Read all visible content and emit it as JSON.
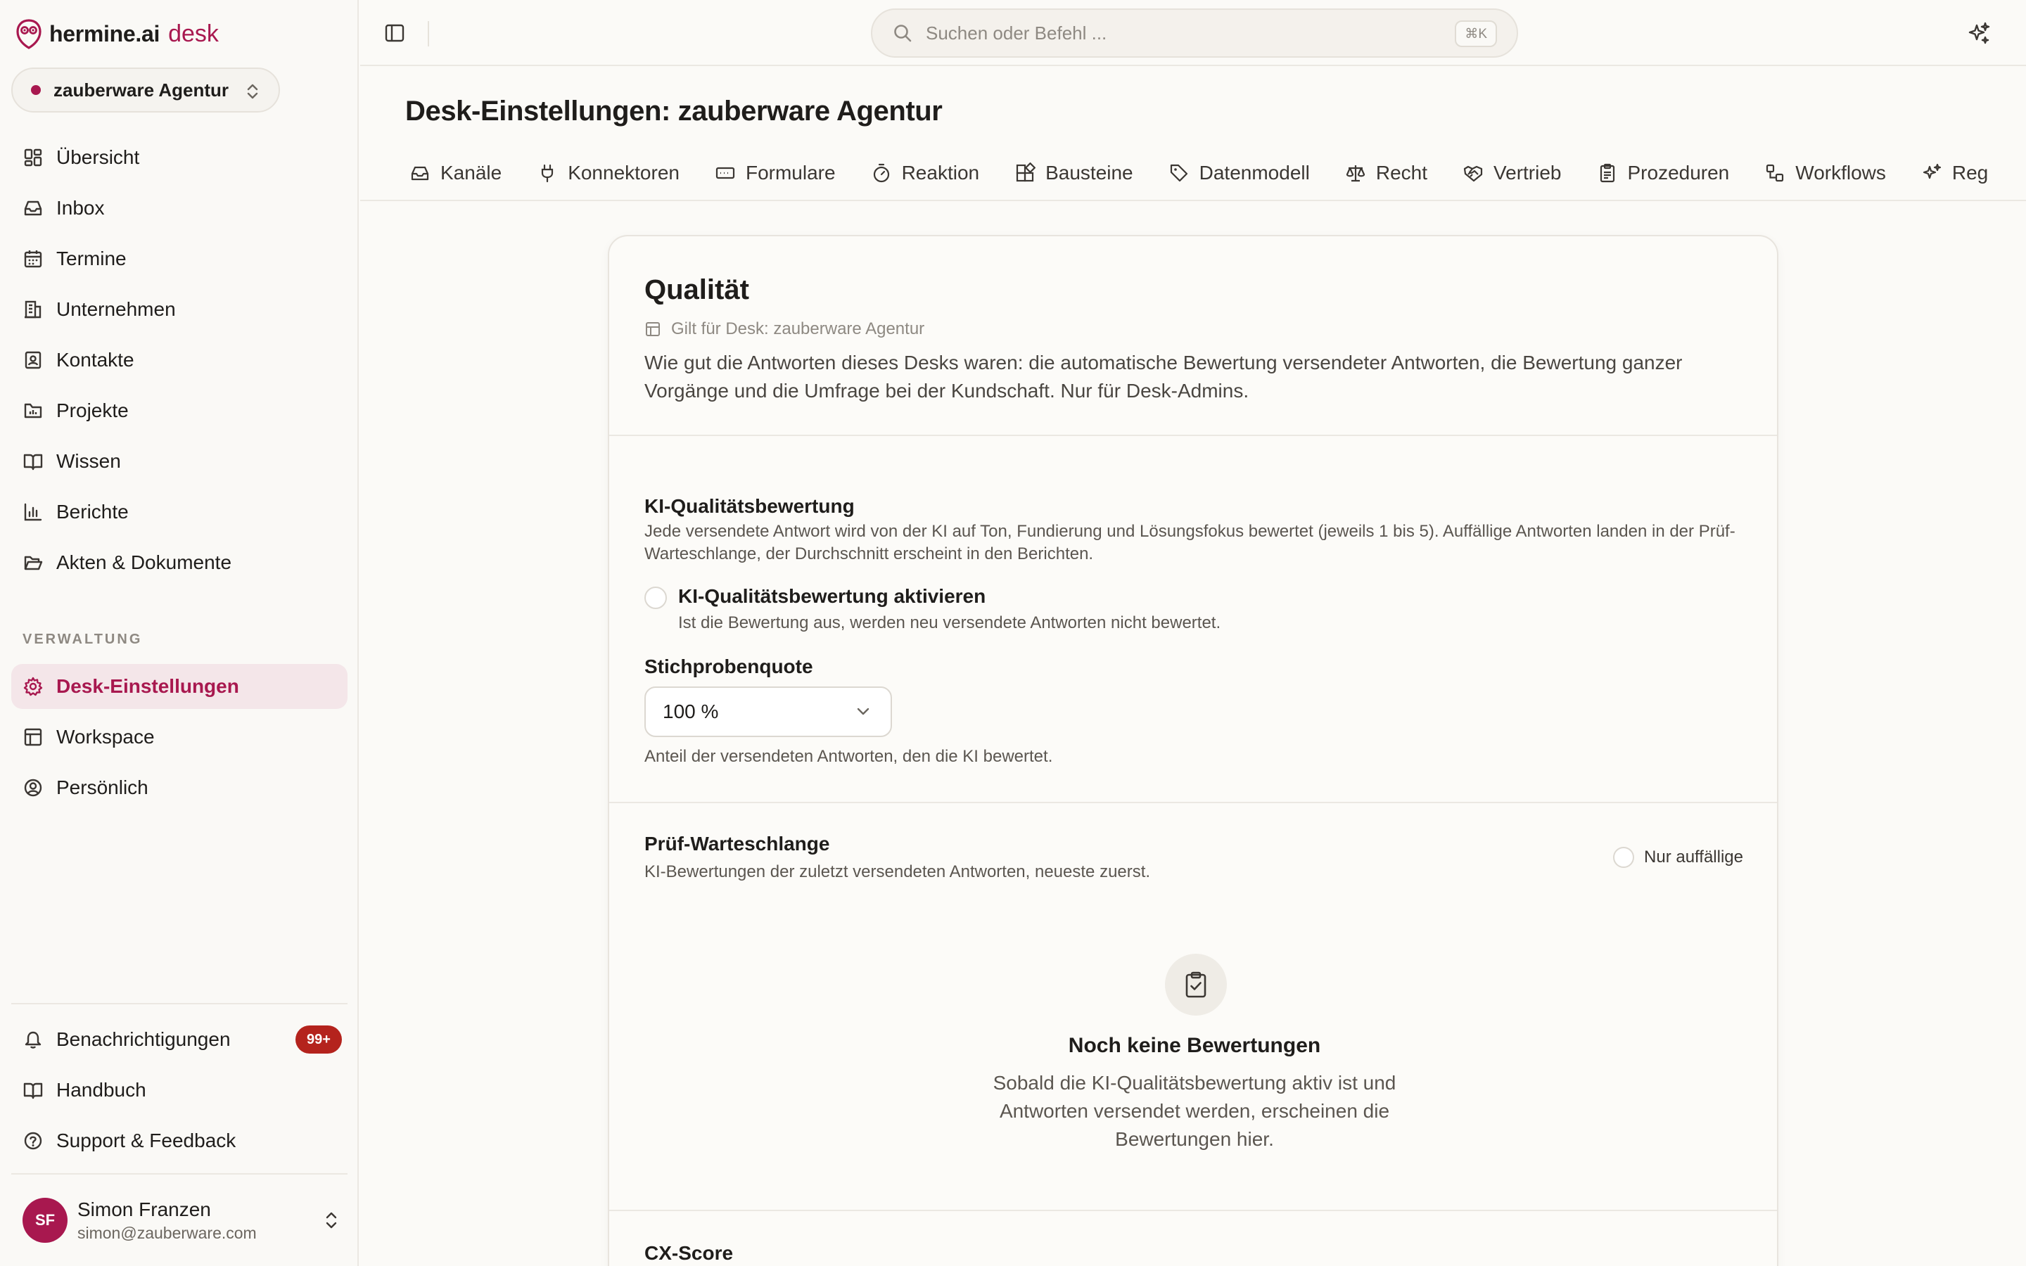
{
  "brand": {
    "name": "hermine.ai",
    "product": "desk"
  },
  "workspace": {
    "name": "zauberware Agentur"
  },
  "nav": {
    "main": [
      {
        "label": "Übersicht",
        "icon": "dashboard-icon"
      },
      {
        "label": "Inbox",
        "icon": "inbox-icon"
      },
      {
        "label": "Termine",
        "icon": "calendar-icon"
      },
      {
        "label": "Unternehmen",
        "icon": "building-icon"
      },
      {
        "label": "Kontakte",
        "icon": "contact-icon"
      },
      {
        "label": "Projekte",
        "icon": "folder-chart-icon"
      },
      {
        "label": "Wissen",
        "icon": "book-icon"
      },
      {
        "label": "Berichte",
        "icon": "bar-chart-icon"
      },
      {
        "label": "Akten & Dokumente",
        "icon": "folder-open-icon"
      }
    ],
    "section_label": "VERWALTUNG",
    "admin": [
      {
        "label": "Desk-Einstellungen",
        "icon": "gear-icon",
        "active": true
      },
      {
        "label": "Workspace",
        "icon": "layout-icon"
      },
      {
        "label": "Persönlich",
        "icon": "user-circle-icon"
      }
    ],
    "footer": [
      {
        "label": "Benachrichtigungen",
        "icon": "bell-icon",
        "badge": "99+"
      },
      {
        "label": "Handbuch",
        "icon": "book-icon"
      },
      {
        "label": "Support & Feedback",
        "icon": "help-circle-icon"
      }
    ]
  },
  "user": {
    "initials": "SF",
    "name": "Simon Franzen",
    "email": "simon@zauberware.com"
  },
  "search": {
    "placeholder": "Suchen oder Befehl ...",
    "shortcut": "⌘K"
  },
  "page": {
    "title": "Desk-Einstellungen: zauberware Agentur"
  },
  "tabs": [
    {
      "label": "Kanäle",
      "icon": "inbox-icon"
    },
    {
      "label": "Konnektoren",
      "icon": "plug-icon"
    },
    {
      "label": "Formulare",
      "icon": "form-icon"
    },
    {
      "label": "Reaktion",
      "icon": "timer-icon"
    },
    {
      "label": "Bausteine",
      "icon": "blocks-icon"
    },
    {
      "label": "Datenmodell",
      "icon": "tag-icon"
    },
    {
      "label": "Recht",
      "icon": "scale-icon"
    },
    {
      "label": "Vertrieb",
      "icon": "handshake-icon"
    },
    {
      "label": "Prozeduren",
      "icon": "clipboard-icon"
    },
    {
      "label": "Workflows",
      "icon": "workflow-icon"
    },
    {
      "label": "Reg",
      "icon": "sparkle-icon"
    }
  ],
  "card": {
    "title": "Qualität",
    "scope": "Gilt für Desk: zauberware Agentur",
    "intro": "Wie gut die Antworten dieses Desks waren: die automatische Bewertung versendeter Antworten, die Bewertung ganzer Vorgänge und die Umfrage bei der Kundschaft. Nur für Desk-Admins.",
    "ki": {
      "title": "KI-Qualitätsbewertung",
      "description": "Jede versendete Antwort wird von der KI auf Ton, Fundierung und Lösungsfokus bewertet (jeweils 1 bis 5). Auffällige Antworten landen in der Prüf-Warteschlange, der Durchschnitt erscheint in den Berichten.",
      "toggle_label": "KI-Qualitätsbewertung aktivieren",
      "toggle_desc": "Ist die Bewertung aus, werden neu versendete Antworten nicht bewertet.",
      "sample_label": "Stichprobenquote",
      "sample_value": "100 %",
      "sample_help": "Anteil der versendeten Antworten, den die KI bewertet."
    },
    "queue": {
      "title": "Prüf-Warteschlange",
      "description": "KI-Bewertungen der zuletzt versendeten Antworten, neueste zuerst.",
      "filter_label": "Nur auffällige",
      "empty_title": "Noch keine Bewertungen",
      "empty_desc": "Sobald die KI-Qualitätsbewertung aktiv ist und Antworten versendet werden, erscheinen die Bewertungen hier."
    },
    "cx": {
      "title": "CX-Score"
    }
  },
  "colors": {
    "accent": "#a8184f",
    "badge": "#b4231d",
    "active_bg": "#f4e6e9"
  }
}
